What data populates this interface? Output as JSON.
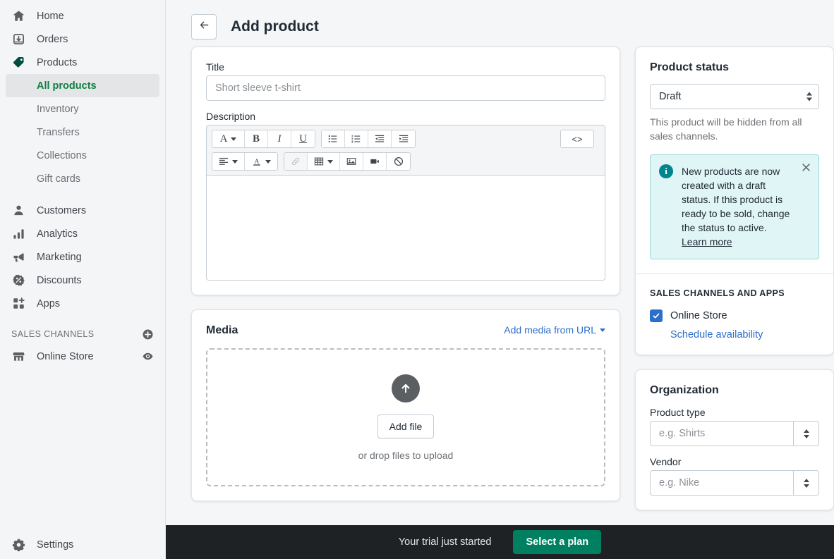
{
  "sidebar": {
    "items": [
      {
        "label": "Home",
        "icon": "home-icon"
      },
      {
        "label": "Orders",
        "icon": "orders-icon"
      },
      {
        "label": "Products",
        "icon": "tag-icon"
      }
    ],
    "product_subitems": [
      {
        "label": "All products",
        "active": true
      },
      {
        "label": "Inventory",
        "active": false
      },
      {
        "label": "Transfers",
        "active": false
      },
      {
        "label": "Collections",
        "active": false
      },
      {
        "label": "Gift cards",
        "active": false
      }
    ],
    "items2": [
      {
        "label": "Customers",
        "icon": "person-icon"
      },
      {
        "label": "Analytics",
        "icon": "bar-chart-icon"
      },
      {
        "label": "Marketing",
        "icon": "megaphone-icon"
      },
      {
        "label": "Discounts",
        "icon": "discount-icon"
      },
      {
        "label": "Apps",
        "icon": "apps-icon"
      }
    ],
    "sales_channels_header": "SALES CHANNELS",
    "add_channel_icon": "plus-circle-icon",
    "online_store": {
      "label": "Online Store",
      "icon": "storefront-icon",
      "action_icon": "eye-icon"
    },
    "settings": {
      "label": "Settings",
      "icon": "gear-icon"
    },
    "active_color": "#108043"
  },
  "header": {
    "back_icon": "arrow-left-icon",
    "title": "Add product"
  },
  "product_form": {
    "title_label": "Title",
    "title_placeholder": "Short sleeve t-shirt",
    "title_value": "",
    "description_label": "Description",
    "description_value": "",
    "toolbar": {
      "row1": [
        {
          "name": "font-style-dropdown",
          "glyph": "A",
          "caret": true
        },
        {
          "name": "bold-button",
          "glyph": "B",
          "caret": false
        },
        {
          "name": "italic-button",
          "glyph": "I",
          "caret": false
        },
        {
          "name": "underline-button",
          "glyph": "U",
          "caret": false
        },
        {
          "name": "bulleted-list-button",
          "glyph": "list-bullet-icon",
          "caret": false
        },
        {
          "name": "numbered-list-button",
          "glyph": "list-number-icon",
          "caret": false
        },
        {
          "name": "outdent-button",
          "glyph": "outdent-icon",
          "caret": false
        },
        {
          "name": "indent-button",
          "glyph": "indent-icon",
          "caret": false
        }
      ],
      "html_button": "<>",
      "row2": [
        {
          "name": "align-dropdown",
          "glyph": "align-left-icon",
          "caret": true
        },
        {
          "name": "text-color-dropdown",
          "glyph": "text-color-icon",
          "caret": true
        },
        {
          "name": "link-button",
          "glyph": "link-icon",
          "caret": false,
          "disabled": true
        },
        {
          "name": "table-dropdown",
          "glyph": "table-icon",
          "caret": true
        },
        {
          "name": "insert-image-button",
          "glyph": "image-icon",
          "caret": false
        },
        {
          "name": "insert-video-button",
          "glyph": "video-icon",
          "caret": false
        },
        {
          "name": "clear-formatting-button",
          "glyph": "no-symbol-icon",
          "caret": false
        }
      ]
    }
  },
  "media": {
    "title": "Media",
    "add_from_url": "Add media from URL",
    "upload_icon": "upload-arrow-icon",
    "add_file_button": "Add file",
    "drop_hint": "or drop files to upload"
  },
  "product_status": {
    "title": "Product status",
    "select_value": "Draft",
    "options": [
      "Draft"
    ],
    "help_text": "This product will be hidden from all sales channels.",
    "banner": {
      "icon": "info-icon",
      "text": "New products are now created with a draft status. If this product is ready to be sold, change the status to active.",
      "link": "Learn more",
      "close_icon": "close-icon",
      "bg_color": "#e0f5f5",
      "icon_color": "#00848e"
    },
    "channels_header": "SALES CHANNELS AND APPS",
    "channel": {
      "label": "Online Store",
      "checked": true,
      "color": "#2c6ecb"
    },
    "schedule_link": "Schedule availability"
  },
  "organization": {
    "title": "Organization",
    "product_type_label": "Product type",
    "product_type_placeholder": "e.g. Shirts",
    "product_type_value": "",
    "vendor_label": "Vendor",
    "vendor_placeholder": "e.g. Nike",
    "vendor_value": ""
  },
  "trial_bar": {
    "text": "Your trial just started",
    "button": "Select a plan",
    "button_color": "#008060",
    "bg_color": "#1f2225"
  }
}
